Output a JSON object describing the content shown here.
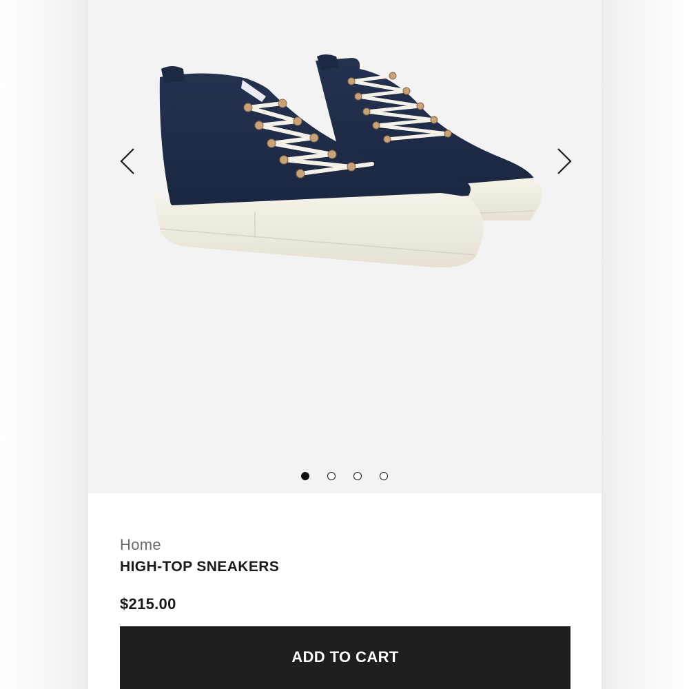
{
  "gallery": {
    "image_icon": "navy-high-top-sneakers-image",
    "prev_icon": "chevron-left-icon",
    "next_icon": "chevron-right-icon",
    "slide_count": 4,
    "active_slide": 1
  },
  "product": {
    "breadcrumb": "Home",
    "title": "HIGH-TOP SNEAKERS",
    "price": "$215.00"
  },
  "actions": {
    "add_to_cart_label": "ADD TO CART"
  },
  "colors": {
    "gallery_bg": "#f3f3f3",
    "button_bg": "#1f1f1f",
    "button_text": "#ffffff",
    "shoe_canvas": "#1f2c48",
    "sole": "#f1ede2"
  }
}
